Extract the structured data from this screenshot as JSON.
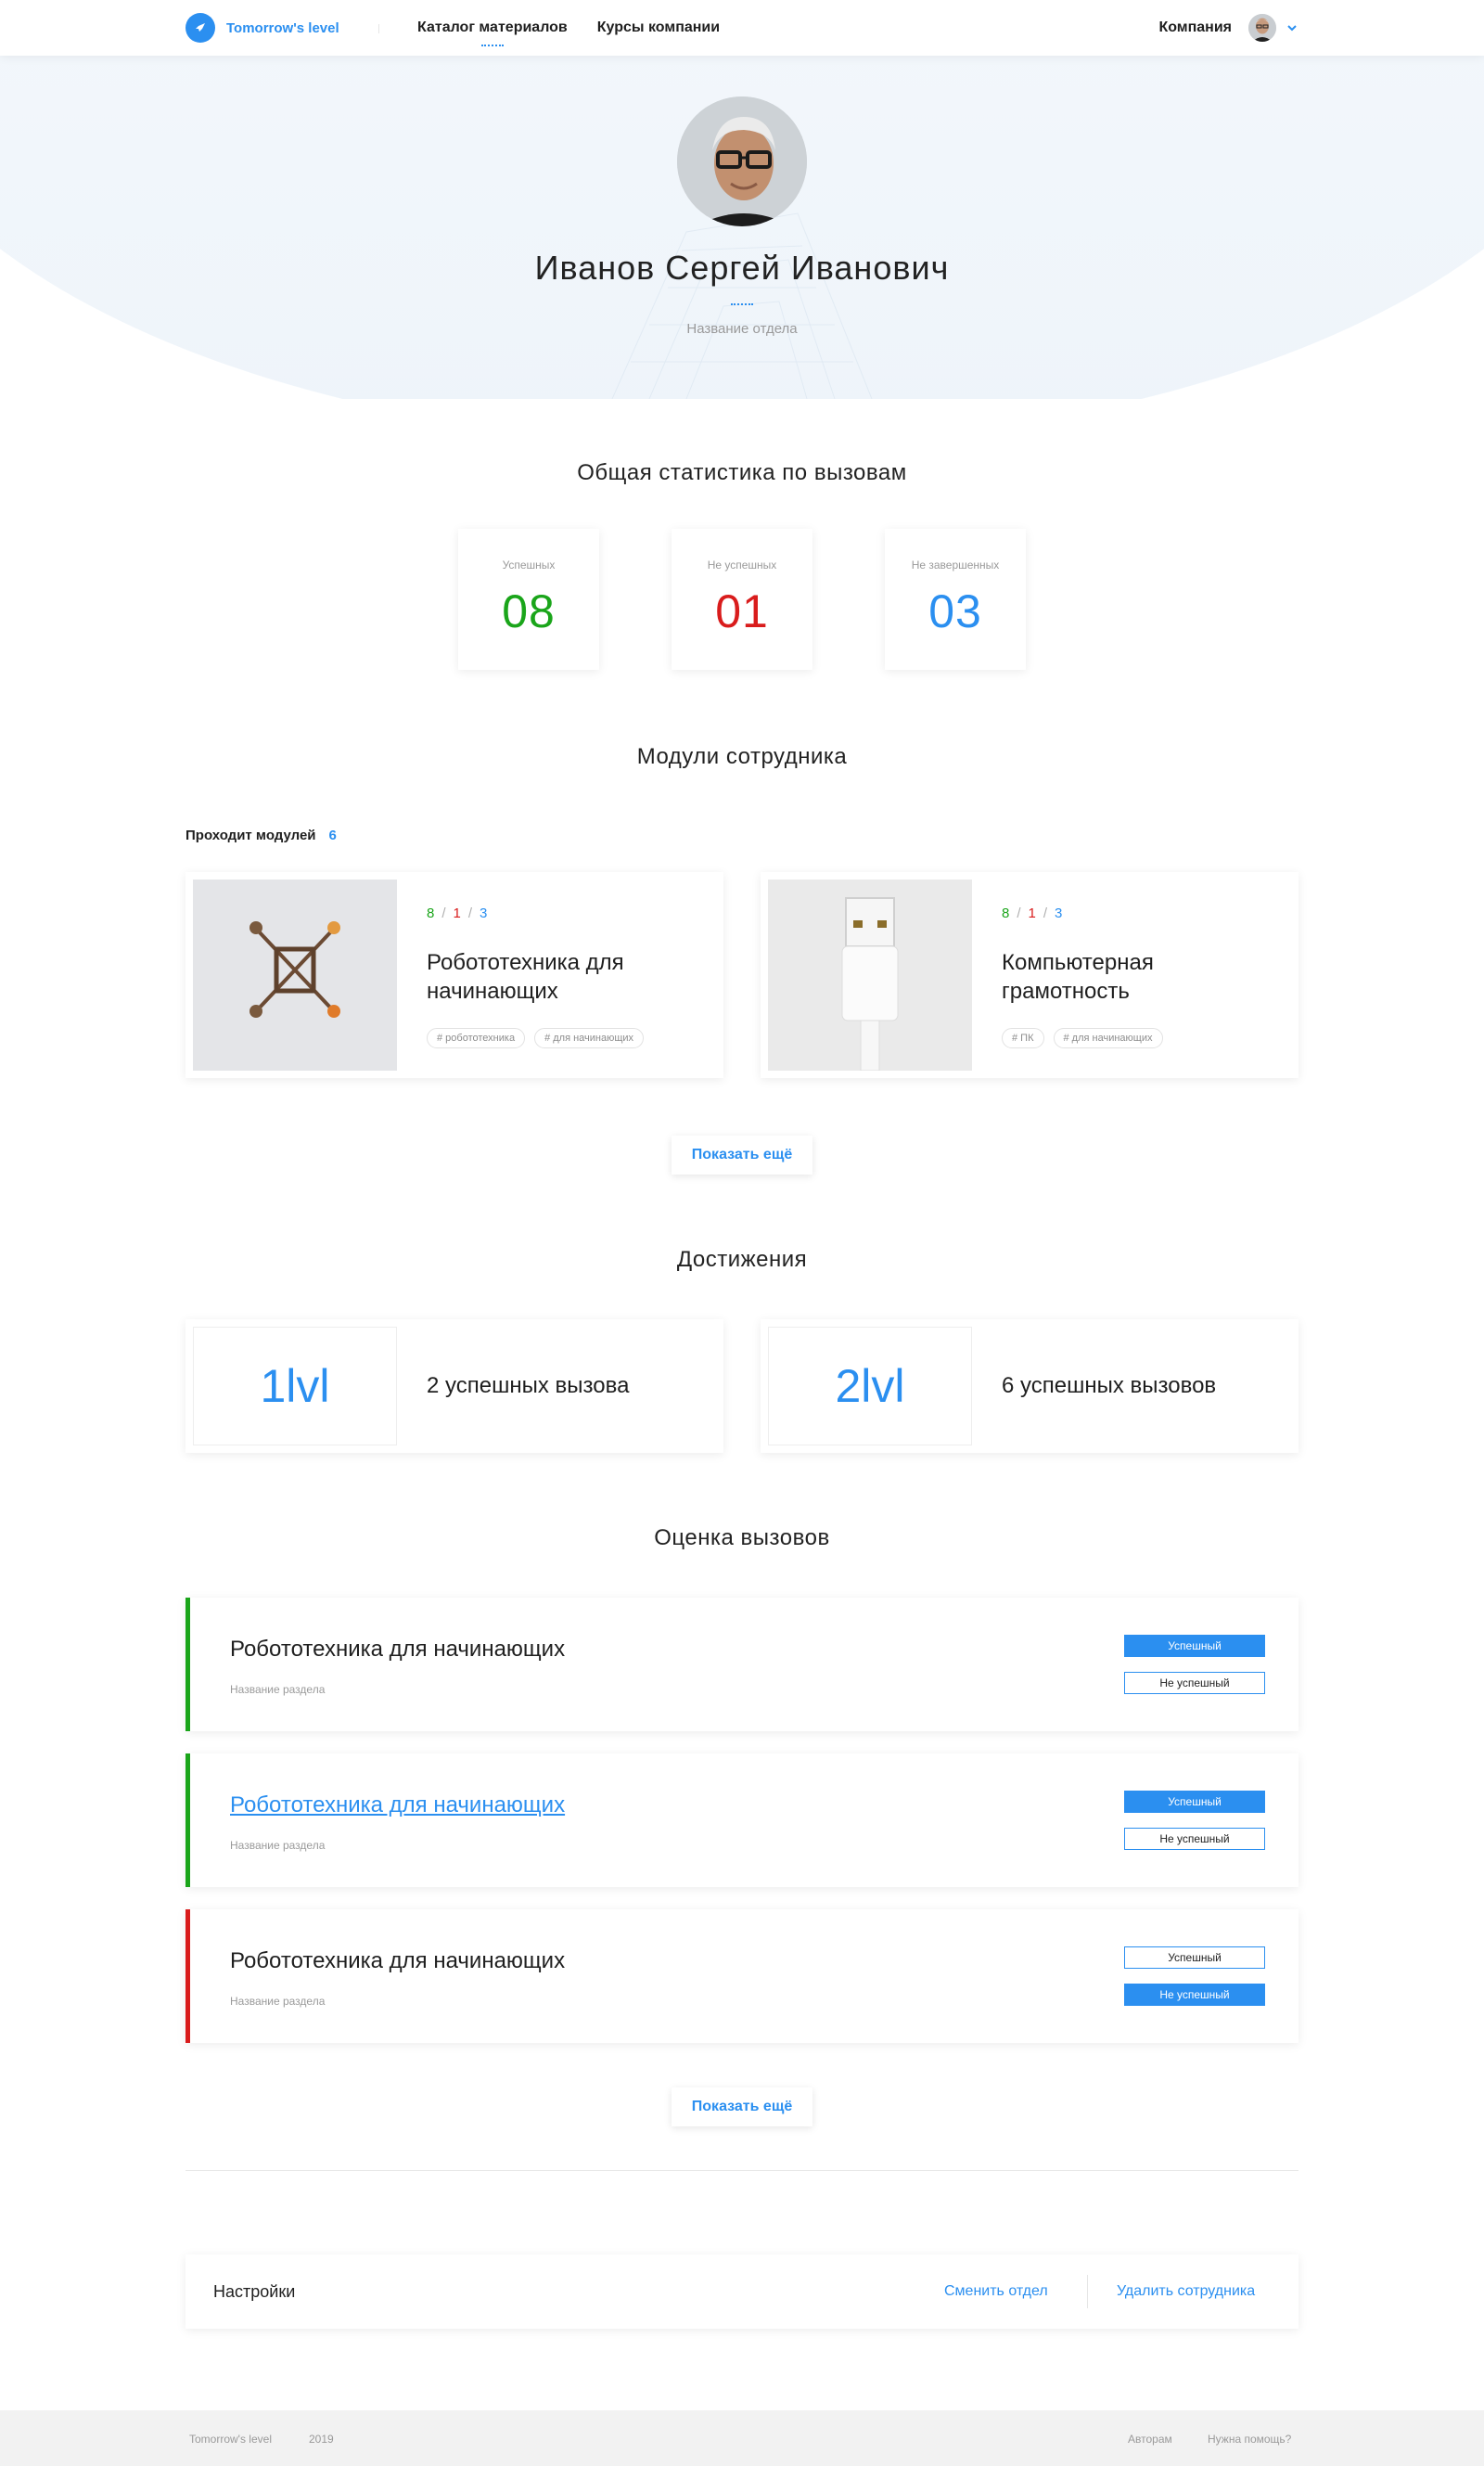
{
  "header": {
    "logo_text": "Tomorrow's level",
    "nav": [
      "Каталог материалов",
      "Курсы компании"
    ],
    "company_label": "Компания"
  },
  "profile": {
    "name": "Иванов Сергей Иванович",
    "department": "Название отдела"
  },
  "stats": {
    "title": "Общая статистика по вызовам",
    "items": [
      {
        "label": "Успешных",
        "value": "08",
        "color": "#1aa51a"
      },
      {
        "label": "Не успешных",
        "value": "01",
        "color": "#d91c1c"
      },
      {
        "label": "Не завершенных",
        "value": "03",
        "color": "#2b8ff0"
      }
    ]
  },
  "modules": {
    "title": "Модули сотрудника",
    "count_label": "Проходит модулей",
    "count": "6",
    "items": [
      {
        "success": "8",
        "fail": "1",
        "pending": "3",
        "title": "Робототехника для начинающих",
        "tags": [
          "# робототехника",
          "# для начинающих"
        ],
        "image": "drone-image"
      },
      {
        "success": "8",
        "fail": "1",
        "pending": "3",
        "title": "Компьютерная грамотность",
        "tags": [
          "# ПК",
          "# для начинающих"
        ],
        "image": "usb-cable-image"
      }
    ],
    "more_label": "Показать ещё"
  },
  "achievements": {
    "title": "Достижения",
    "items": [
      {
        "level": "1lvl",
        "text": "2 успешных вызова"
      },
      {
        "level": "2lvl",
        "text": "6 успешных вызовов"
      }
    ]
  },
  "evaluations": {
    "title": "Оценка вызовов",
    "success_label": "Успешный",
    "fail_label": "Не успешный",
    "items": [
      {
        "title": "Робототехника для начинающих",
        "section": "Название раздела",
        "status": "success",
        "bar_color": "#1aa51a"
      },
      {
        "title": "Робототехника для начинающих",
        "section": "Название раздела",
        "status": "success",
        "bar_color": "#1aa51a"
      },
      {
        "title": "Робототехника для начинающих",
        "section": "Название раздела",
        "status": "fail",
        "bar_color": "#d91c1c"
      }
    ],
    "more_label": "Показать ещё"
  },
  "settings": {
    "title": "Настройки",
    "change_department": "Сменить отдел",
    "delete_employee": "Удалить сотрудника"
  },
  "footer": {
    "brand": "Tomorrow's level",
    "year": "2019",
    "authors": "Авторам",
    "help": "Нужна помощь?"
  },
  "colors": {
    "accent": "#2b8ff0",
    "success": "#1aa51a",
    "fail": "#d91c1c"
  }
}
